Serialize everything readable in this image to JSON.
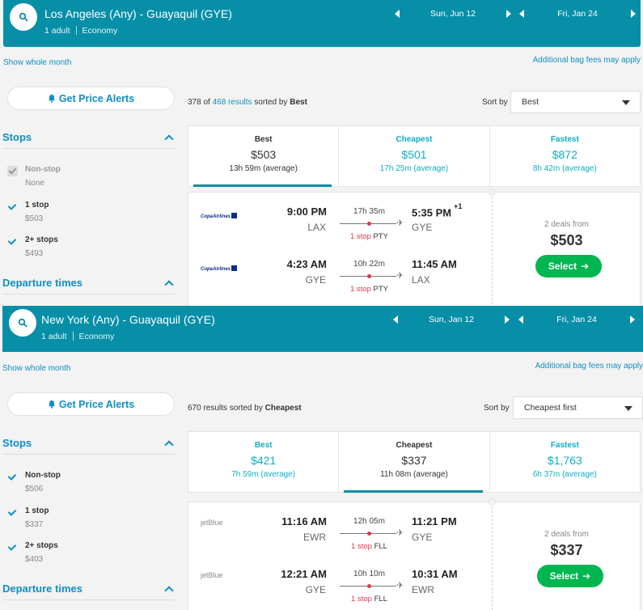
{
  "panels": [
    {
      "search": {
        "route": "Los Angeles (Any) - Guayaquil (GYE)",
        "travelers": "1 adult",
        "cabin": "Economy",
        "depart_date": "Sun, Jun 12",
        "return_date": "Fri, Jan 24"
      },
      "show_whole_month": "Show whole month",
      "bag_fees": "Additional bag fees may apply",
      "price_alerts": "Get Price Alerts",
      "results": {
        "shown": "378",
        "of": "of",
        "total": "468 results",
        "sorted_by": "sorted by",
        "sort_name": "Best"
      },
      "sort": {
        "label": "Sort by",
        "value": "Best"
      },
      "filters": {
        "stops_title": "Stops",
        "stops": [
          {
            "name": "Non-stop",
            "price": "None"
          },
          {
            "name": "1 stop",
            "price": "$503"
          },
          {
            "name": "2+ stops",
            "price": "$493"
          }
        ],
        "departure_title": "Departure times"
      },
      "tabs": [
        {
          "title": "Best",
          "price": "$503",
          "sub": "13h 59m (average)"
        },
        {
          "title": "Cheapest",
          "price": "$501",
          "sub": "17h 25m (average)"
        },
        {
          "title": "Fastest",
          "price": "$872",
          "sub": "8h 42m (average)"
        }
      ],
      "card": {
        "legs": [
          {
            "airline": "CopaAirlines",
            "dep_time": "9:00 PM",
            "dep_code": "LAX",
            "duration": "17h 35m",
            "stops": "1 stop",
            "via": "PTY",
            "arr_time": "5:35 PM",
            "day_offset": "+1",
            "arr_code": "GYE"
          },
          {
            "airline": "CopaAirlines",
            "dep_time": "4:23 AM",
            "dep_code": "GYE",
            "duration": "10h 22m",
            "stops": "1 stop",
            "via": "PTY",
            "arr_time": "11:45 AM",
            "day_offset": "",
            "arr_code": "LAX"
          }
        ],
        "deals": "2 deals from",
        "price": "$503",
        "select": "Select"
      }
    },
    {
      "search": {
        "route": "New York (Any) - Guayaquil (GYE)",
        "travelers": "1 adult",
        "cabin": "Economy",
        "depart_date": "Sun, Jan 12",
        "return_date": "Fri, Jan 24"
      },
      "show_whole_month": "Show whole month",
      "bag_fees": "Additional bag fees may apply",
      "price_alerts": "Get Price Alerts",
      "results": {
        "shown": "670 results",
        "sorted_by": "sorted by",
        "sort_name": "Cheapest"
      },
      "sort": {
        "label": "Sort by",
        "value": "Cheapest first"
      },
      "filters": {
        "stops_title": "Stops",
        "stops": [
          {
            "name": "Non-stop",
            "price": "$506"
          },
          {
            "name": "1 stop",
            "price": "$337"
          },
          {
            "name": "2+ stops",
            "price": "$403"
          }
        ],
        "departure_title": "Departure times"
      },
      "tabs": [
        {
          "title": "Best",
          "price": "$421",
          "sub": "7h 59m (average)"
        },
        {
          "title": "Cheapest",
          "price": "$337",
          "sub": "11h 08m (average)"
        },
        {
          "title": "Fastest",
          "price": "$1,763",
          "sub": "6h 37m (average)"
        }
      ],
      "card": {
        "legs": [
          {
            "airline": "jetBlue",
            "dep_time": "11:16 AM",
            "dep_code": "EWR",
            "duration": "12h 05m",
            "stops": "1 stop",
            "via": "FLL",
            "arr_time": "11:21 PM",
            "day_offset": "",
            "arr_code": "GYE"
          },
          {
            "airline": "jetBlue",
            "dep_time": "12:21 AM",
            "dep_code": "GYE",
            "duration": "10h 10m",
            "stops": "1 stop",
            "via": "FLL",
            "arr_time": "10:31 AM",
            "day_offset": "",
            "arr_code": "EWR"
          }
        ],
        "deals": "2 deals from",
        "price": "$337",
        "select": "Select"
      }
    }
  ],
  "colors": {
    "header": "#078fa8",
    "accent": "#0f8ec4",
    "select": "#00b650",
    "stop_red": "#e0364a"
  }
}
